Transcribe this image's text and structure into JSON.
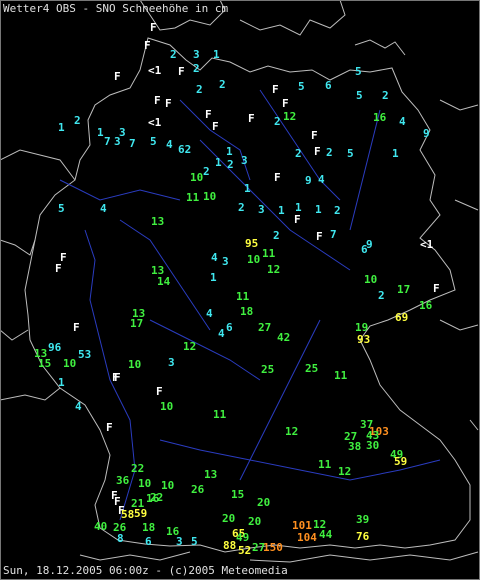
{
  "header": "Wetter4 OBS - SNO Schneehöhe in cm",
  "footer": "Sun, 18.12.2005 06:00z - (c)2005 Meteomedia",
  "colors": {
    "cyan": "#40e8f0",
    "green": "#40f040",
    "yellow": "#ffff40",
    "orange": "#ff9020",
    "white": "#ffffff"
  },
  "stations": [
    {
      "t": "F",
      "c": "white"
    },
    {
      "t": "F",
      "c": "white"
    },
    {
      "t": "2",
      "c": "cyan"
    },
    {
      "t": "3",
      "c": "cyan"
    },
    {
      "t": "1",
      "c": "cyan"
    },
    {
      "t": "F",
      "c": "white"
    },
    {
      "t": "<1",
      "c": "white"
    },
    {
      "t": "F",
      "c": "white"
    },
    {
      "t": "2",
      "c": "cyan"
    },
    {
      "t": "2",
      "c": "cyan"
    },
    {
      "t": "F",
      "c": "white"
    },
    {
      "t": "2",
      "c": "cyan"
    },
    {
      "t": "5",
      "c": "cyan"
    },
    {
      "t": "6",
      "c": "cyan"
    },
    {
      "t": "5",
      "c": "cyan"
    },
    {
      "t": "F",
      "c": "white"
    },
    {
      "t": "5",
      "c": "cyan"
    },
    {
      "t": "2",
      "c": "cyan"
    },
    {
      "t": "F",
      "c": "white"
    },
    {
      "t": "F",
      "c": "white"
    },
    {
      "t": "F",
      "c": "white"
    },
    {
      "t": "<1",
      "c": "white"
    },
    {
      "t": "F",
      "c": "white"
    },
    {
      "t": "2",
      "c": "cyan"
    },
    {
      "t": "F",
      "c": "white"
    },
    {
      "t": "12",
      "c": "green"
    },
    {
      "t": "16",
      "c": "green"
    },
    {
      "t": "4",
      "c": "cyan"
    },
    {
      "t": "9",
      "c": "cyan"
    },
    {
      "t": "1",
      "c": "cyan"
    },
    {
      "t": "2",
      "c": "cyan"
    },
    {
      "t": "1",
      "c": "cyan"
    },
    {
      "t": "7",
      "c": "cyan"
    },
    {
      "t": "3",
      "c": "cyan"
    },
    {
      "t": "F",
      "c": "white"
    },
    {
      "t": "3",
      "c": "cyan"
    },
    {
      "t": "7",
      "c": "cyan"
    },
    {
      "t": "5",
      "c": "cyan"
    },
    {
      "t": "4",
      "c": "cyan"
    },
    {
      "t": "62",
      "c": "cyan"
    },
    {
      "t": "1",
      "c": "cyan"
    },
    {
      "t": "2",
      "c": "cyan"
    },
    {
      "t": "3",
      "c": "cyan"
    },
    {
      "t": "1",
      "c": "cyan"
    },
    {
      "t": "F",
      "c": "white"
    },
    {
      "t": "2",
      "c": "cyan"
    },
    {
      "t": "2",
      "c": "cyan"
    },
    {
      "t": "5",
      "c": "cyan"
    },
    {
      "t": "1",
      "c": "cyan"
    },
    {
      "t": "10",
      "c": "green"
    },
    {
      "t": "F",
      "c": "white"
    },
    {
      "t": "9",
      "c": "cyan"
    },
    {
      "t": "4",
      "c": "cyan"
    },
    {
      "t": "2",
      "c": "cyan"
    },
    {
      "t": "1",
      "c": "cyan"
    },
    {
      "t": "11",
      "c": "green"
    },
    {
      "t": "10",
      "c": "green"
    },
    {
      "t": "2",
      "c": "cyan"
    },
    {
      "t": "3",
      "c": "cyan"
    },
    {
      "t": "1",
      "c": "cyan"
    },
    {
      "t": "F",
      "c": "white"
    },
    {
      "t": "1",
      "c": "cyan"
    },
    {
      "t": "13",
      "c": "green"
    },
    {
      "t": "5",
      "c": "cyan"
    },
    {
      "t": "4",
      "c": "cyan"
    },
    {
      "t": "1",
      "c": "cyan"
    },
    {
      "t": "2",
      "c": "cyan"
    },
    {
      "t": "F",
      "c": "white"
    },
    {
      "t": "2",
      "c": "cyan"
    },
    {
      "t": "95",
      "c": "yellow"
    },
    {
      "t": "10",
      "c": "green"
    },
    {
      "t": "11",
      "c": "green"
    },
    {
      "t": "7",
      "c": "cyan"
    },
    {
      "t": "9",
      "c": "cyan"
    },
    {
      "t": "<1",
      "c": "white"
    },
    {
      "t": "F",
      "c": "white"
    },
    {
      "t": "F",
      "c": "white"
    },
    {
      "t": "13",
      "c": "green"
    },
    {
      "t": "4",
      "c": "cyan"
    },
    {
      "t": "3",
      "c": "cyan"
    },
    {
      "t": "1",
      "c": "cyan"
    },
    {
      "t": "12",
      "c": "green"
    },
    {
      "t": "6",
      "c": "cyan"
    },
    {
      "t": "10",
      "c": "green"
    },
    {
      "t": "14",
      "c": "green"
    },
    {
      "t": "17",
      "c": "green"
    },
    {
      "t": "F",
      "c": "white"
    },
    {
      "t": "13",
      "c": "green"
    },
    {
      "t": "2",
      "c": "cyan"
    },
    {
      "t": "11",
      "c": "green"
    },
    {
      "t": "4",
      "c": "cyan"
    },
    {
      "t": "6",
      "c": "cyan"
    },
    {
      "t": "18",
      "c": "green"
    },
    {
      "t": "69",
      "c": "yellow"
    },
    {
      "t": "16",
      "c": "green"
    },
    {
      "t": "F",
      "c": "white"
    },
    {
      "t": "17",
      "c": "green"
    },
    {
      "t": "4",
      "c": "cyan"
    },
    {
      "t": "27",
      "c": "green"
    },
    {
      "t": "42",
      "c": "green"
    },
    {
      "t": "25",
      "c": "green"
    },
    {
      "t": "19",
      "c": "green"
    },
    {
      "t": "93",
      "c": "yellow"
    },
    {
      "t": "13",
      "c": "green"
    },
    {
      "t": "96",
      "c": "cyan"
    },
    {
      "t": "53",
      "c": "cyan"
    },
    {
      "t": "15",
      "c": "green"
    },
    {
      "t": "10",
      "c": "green"
    },
    {
      "t": "3",
      "c": "cyan"
    },
    {
      "t": "10",
      "c": "green"
    },
    {
      "t": "12",
      "c": "green"
    },
    {
      "t": "F",
      "c": "white"
    },
    {
      "t": "F",
      "c": "white"
    },
    {
      "t": "1",
      "c": "cyan"
    },
    {
      "t": "4",
      "c": "cyan"
    },
    {
      "t": "25",
      "c": "green"
    },
    {
      "t": "11",
      "c": "green"
    },
    {
      "t": "F",
      "c": "white"
    },
    {
      "t": "F",
      "c": "white"
    },
    {
      "t": "10",
      "c": "green"
    },
    {
      "t": "37",
      "c": "green"
    },
    {
      "t": "103",
      "c": "orange"
    },
    {
      "t": "11",
      "c": "green"
    },
    {
      "t": "12",
      "c": "green"
    },
    {
      "t": "27",
      "c": "green"
    },
    {
      "t": "43",
      "c": "green"
    },
    {
      "t": "38",
      "c": "green"
    },
    {
      "t": "30",
      "c": "green"
    },
    {
      "t": "49",
      "c": "green"
    },
    {
      "t": "59",
      "c": "yellow"
    },
    {
      "t": "22",
      "c": "green"
    },
    {
      "t": "36",
      "c": "green"
    },
    {
      "t": "10",
      "c": "green"
    },
    {
      "t": "16",
      "c": "green"
    },
    {
      "t": "11",
      "c": "green"
    },
    {
      "t": "12",
      "c": "green"
    },
    {
      "t": "26",
      "c": "green"
    },
    {
      "t": "F",
      "c": "white"
    },
    {
      "t": "10",
      "c": "green"
    },
    {
      "t": "21",
      "c": "green"
    },
    {
      "t": "13",
      "c": "green"
    },
    {
      "t": "15",
      "c": "green"
    },
    {
      "t": "20",
      "c": "green"
    },
    {
      "t": "F",
      "c": "white"
    },
    {
      "t": "22",
      "c": "green"
    },
    {
      "t": "20",
      "c": "green"
    },
    {
      "t": "F",
      "c": "white"
    },
    {
      "t": "58",
      "c": "yellow"
    },
    {
      "t": "59",
      "c": "yellow"
    },
    {
      "t": "40",
      "c": "green"
    },
    {
      "t": "26",
      "c": "green"
    },
    {
      "t": "18",
      "c": "green"
    },
    {
      "t": "16",
      "c": "green"
    },
    {
      "t": "20",
      "c": "green"
    },
    {
      "t": "65",
      "c": "yellow"
    },
    {
      "t": "101",
      "c": "orange"
    },
    {
      "t": "44",
      "c": "green"
    },
    {
      "t": "12",
      "c": "green"
    },
    {
      "t": "39",
      "c": "green"
    },
    {
      "t": "104",
      "c": "orange"
    },
    {
      "t": "76",
      "c": "yellow"
    },
    {
      "t": "49",
      "c": "green"
    },
    {
      "t": "27",
      "c": "green"
    },
    {
      "t": "88",
      "c": "yellow"
    },
    {
      "t": "52",
      "c": "yellow"
    },
    {
      "t": "150",
      "c": "orange"
    },
    {
      "t": "8",
      "c": "cyan"
    },
    {
      "t": "6",
      "c": "cyan"
    },
    {
      "t": "3",
      "c": "cyan"
    },
    {
      "t": "5",
      "c": "cyan"
    }
  ]
}
